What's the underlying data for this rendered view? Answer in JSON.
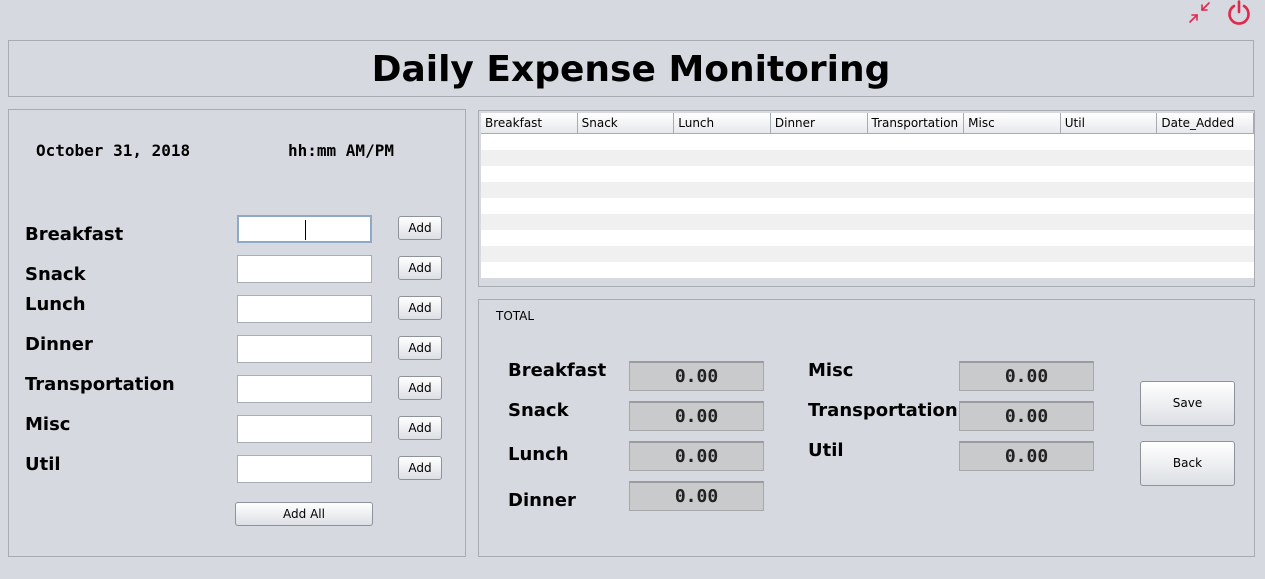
{
  "window": {
    "title": "Daily Expense Monitoring",
    "minimize_icon": "compress-arrows-icon",
    "power_icon": "power-icon",
    "accent_color": "#e0284e"
  },
  "entry": {
    "date": "October 31, 2018",
    "time": "hh:mm AM/PM",
    "fields": [
      {
        "label": "Breakfast",
        "value": "",
        "button": "Add"
      },
      {
        "label": "Snack",
        "value": "",
        "button": "Add"
      },
      {
        "label": "Lunch",
        "value": "",
        "button": "Add"
      },
      {
        "label": "Dinner",
        "value": "",
        "button": "Add"
      },
      {
        "label": "Transportation",
        "value": "",
        "button": "Add"
      },
      {
        "label": "Misc",
        "value": "",
        "button": "Add"
      },
      {
        "label": "Util",
        "value": "",
        "button": "Add"
      }
    ],
    "add_all_label": "Add All"
  },
  "table": {
    "columns": [
      "Breakfast",
      "Snack",
      "Lunch",
      "Dinner",
      "Transportation",
      "Misc",
      "Util",
      "Date_Added"
    ],
    "rows": []
  },
  "totals": {
    "legend": "TOTAL",
    "left": [
      {
        "label": "Breakfast",
        "value": "0.00"
      },
      {
        "label": "Snack",
        "value": "0.00"
      },
      {
        "label": "Lunch",
        "value": "0.00"
      },
      {
        "label": "Dinner",
        "value": "0.00"
      }
    ],
    "right": [
      {
        "label": "Misc",
        "value": "0.00"
      },
      {
        "label": "Transportation",
        "value": "0.00"
      },
      {
        "label": "Util",
        "value": "0.00"
      }
    ],
    "save_label": "Save",
    "back_label": "Back"
  }
}
